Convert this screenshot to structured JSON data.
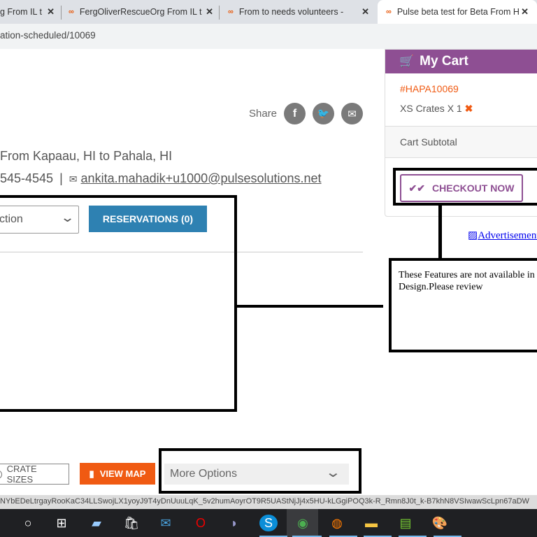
{
  "browser": {
    "tabs": [
      {
        "title": "g From IL t",
        "active": false
      },
      {
        "title": "FergOliverRescueOrg From IL t",
        "active": false
      },
      {
        "title": "From to needs volunteers -",
        "active": false
      },
      {
        "title": "Pulse beta test for Beta From H",
        "active": true
      }
    ],
    "address": "ation-scheduled/10069",
    "status_url": "NYbEDeLtrgayRooKaC34LLSwojLX1yoyJ9T4yDnUuuLqK_5v2humAoyrOT9R5UAStNjJj4x5HU-kLGgiPOQ3k-R_Rmn8J0t_k-B7khN8VSIwawScLpn67aDW"
  },
  "share": {
    "label": "Share",
    "icons": [
      "facebook-icon",
      "twitter-icon",
      "email-icon"
    ]
  },
  "route": "From Kapaau, HI to Pahala, HI",
  "contact": {
    "phone": "545-4545",
    "separator": "|",
    "email": "ankita.mahadik+u1000@pulsesolutions.net"
  },
  "select": {
    "value": "ction"
  },
  "reservations_label": "RESERVATIONS (0)",
  "cart": {
    "title": "My Cart",
    "order_id": "#HAPA10069",
    "item": "XS Crates X 1",
    "subtotal_label": "Cart Subtotal",
    "checkout_label": "CHECKOUT NOW"
  },
  "ad_alt": "Advertisement",
  "annotation": "These Features are not available in Design.Please review",
  "bottom": {
    "crate_sizes": "CRATE SIZES",
    "view_map": "VIEW MAP",
    "more_options": "More Options"
  },
  "colors": {
    "purple": "#8e4f93",
    "orange": "#f05a12",
    "blue": "#2e81b2",
    "accent_red": "#e8590c"
  }
}
